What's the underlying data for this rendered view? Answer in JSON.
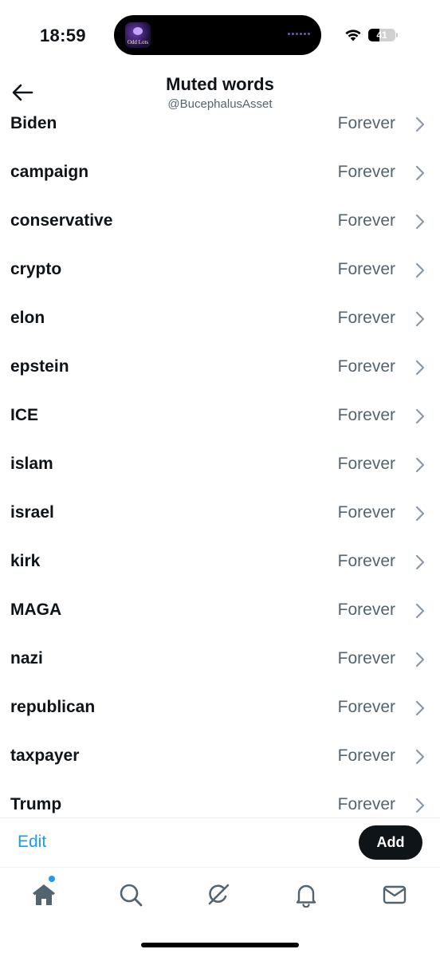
{
  "status_bar": {
    "time": "18:59",
    "battery_level": 41,
    "battery_text": "41",
    "island_art_text": "Odd Lots"
  },
  "header": {
    "title": "Muted words",
    "subtitle": "@BucephalusAsset",
    "back_icon": "arrow-left-icon"
  },
  "muted_words": [
    {
      "word": "Biden",
      "duration": "Forever"
    },
    {
      "word": "campaign",
      "duration": "Forever"
    },
    {
      "word": "conservative",
      "duration": "Forever"
    },
    {
      "word": "crypto",
      "duration": "Forever"
    },
    {
      "word": "elon",
      "duration": "Forever"
    },
    {
      "word": "epstein",
      "duration": "Forever"
    },
    {
      "word": "ICE",
      "duration": "Forever"
    },
    {
      "word": "islam",
      "duration": "Forever"
    },
    {
      "word": "israel",
      "duration": "Forever"
    },
    {
      "word": "kirk",
      "duration": "Forever"
    },
    {
      "word": "MAGA",
      "duration": "Forever"
    },
    {
      "word": "nazi",
      "duration": "Forever"
    },
    {
      "word": "republican",
      "duration": "Forever"
    },
    {
      "word": "taxpayer",
      "duration": "Forever"
    },
    {
      "word": "Trump",
      "duration": "Forever"
    }
  ],
  "actions": {
    "edit_label": "Edit",
    "add_label": "Add"
  },
  "tab_bar": {
    "tabs": [
      {
        "icon": "home-icon",
        "active": true,
        "has_notification_dot": true
      },
      {
        "icon": "search-icon",
        "active": false
      },
      {
        "icon": "grok-icon",
        "active": false
      },
      {
        "icon": "bell-icon",
        "active": false
      },
      {
        "icon": "mail-icon",
        "active": false
      }
    ]
  },
  "colors": {
    "accent": "#1d9bf0",
    "text_primary": "#0f1419",
    "text_secondary": "#536471",
    "chevron": "#8b98a5",
    "tab_icon": "#536471"
  }
}
